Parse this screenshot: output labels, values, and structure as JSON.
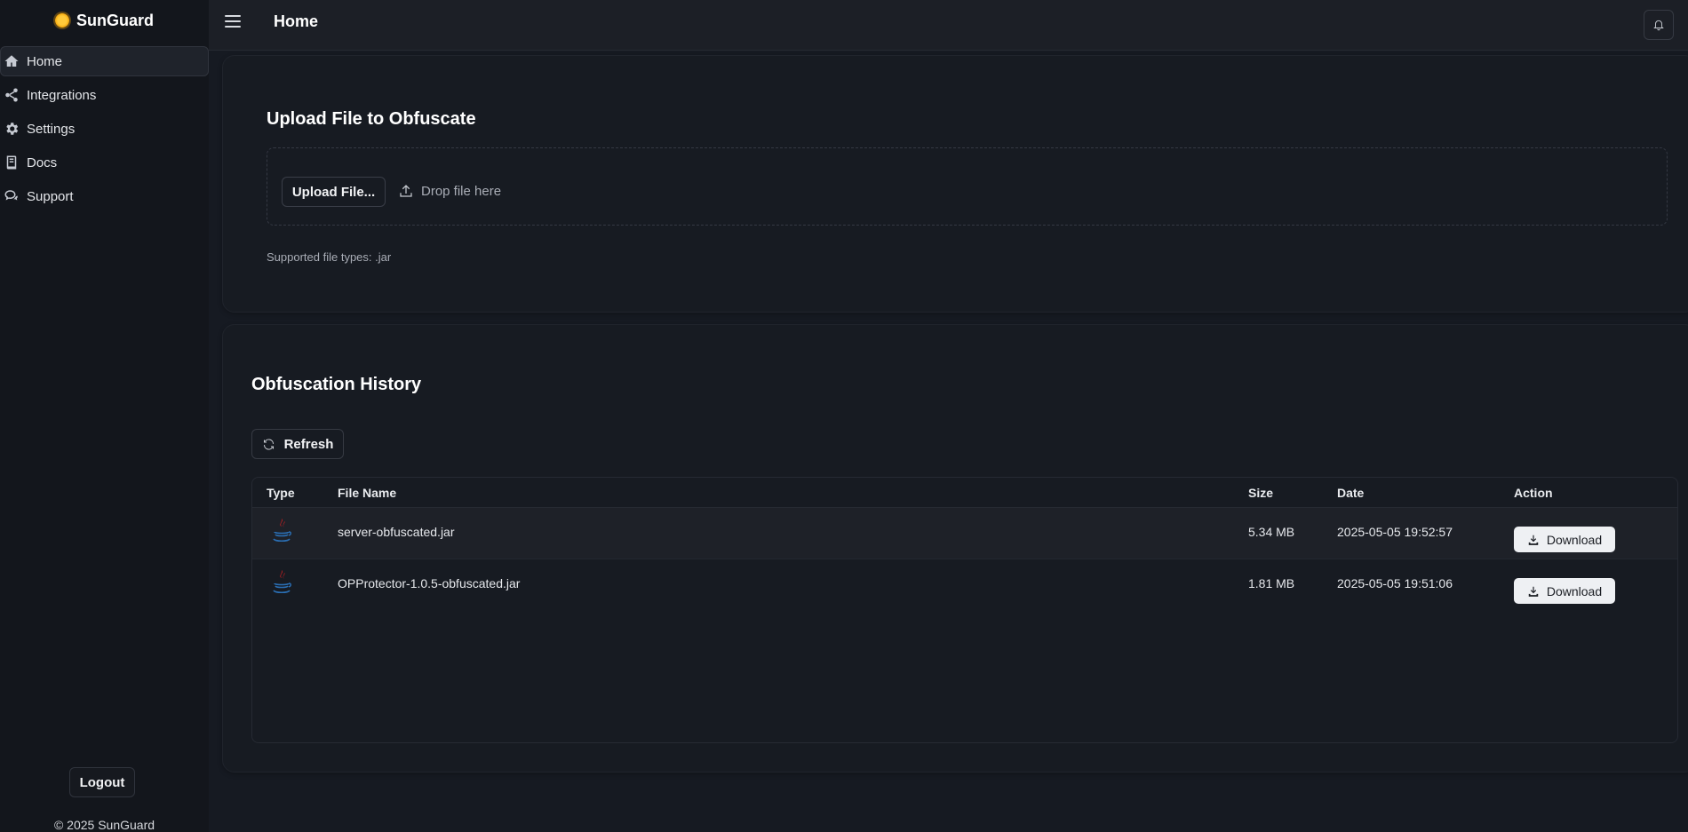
{
  "brand": {
    "name": "SunGuard"
  },
  "sidebar": {
    "items": [
      {
        "label": "Home",
        "icon": "home-icon"
      },
      {
        "label": "Integrations",
        "icon": "share-icon"
      },
      {
        "label": "Settings",
        "icon": "gear-icon"
      },
      {
        "label": "Docs",
        "icon": "book-icon"
      },
      {
        "label": "Support",
        "icon": "chat-icon"
      }
    ],
    "logout_label": "Logout",
    "copyright": "© 2025 SunGuard"
  },
  "header": {
    "title": "Home"
  },
  "upload": {
    "title": "Upload File to Obfuscate",
    "button_label": "Upload File...",
    "drop_hint": "Drop file here",
    "supported": "Supported file types: .jar"
  },
  "history": {
    "title": "Obfuscation History",
    "refresh_label": "Refresh",
    "columns": [
      "Type",
      "File Name",
      "Size",
      "Date",
      "Action"
    ],
    "rows": [
      {
        "name": "server-obfuscated.jar",
        "size": "5.34 MB",
        "date": "2025-05-05 19:52:57",
        "action": "Download"
      },
      {
        "name": "OPProtector-1.0.5-obfuscated.jar",
        "size": "1.81 MB",
        "date": "2025-05-05 19:51:06",
        "action": "Download"
      }
    ]
  },
  "colors": {
    "background": "#161a22",
    "sidebar": "#13161c",
    "accent_sun": "#f5a70a",
    "java_red": "#e11f21",
    "java_blue": "#2a6fb5"
  }
}
